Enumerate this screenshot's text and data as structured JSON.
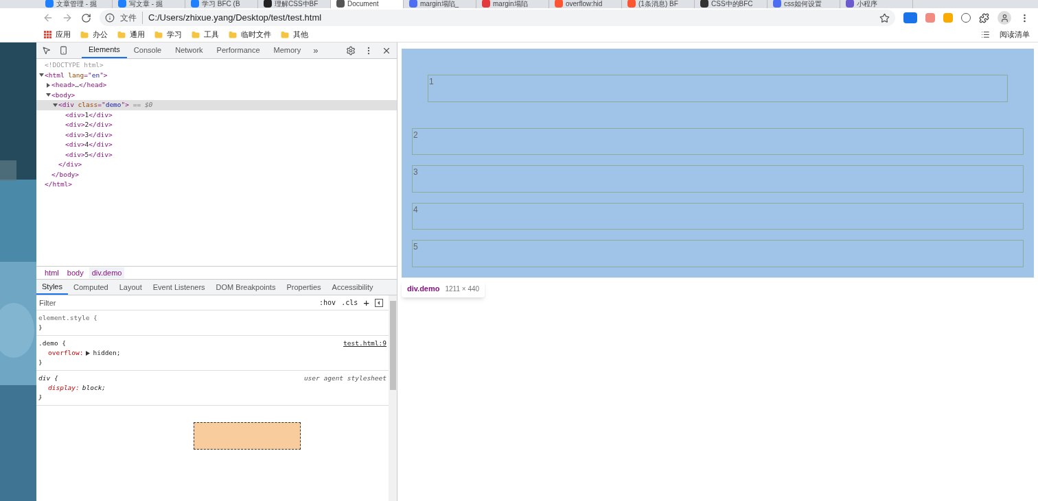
{
  "browser_tabs": [
    {
      "title": "文章管理 - 掘",
      "selected": false,
      "color": "#1e80ff"
    },
    {
      "title": "写文章 - 掘",
      "selected": false,
      "color": "#1e80ff"
    },
    {
      "title": "学习 BFC (B",
      "selected": false,
      "color": "#1e80ff"
    },
    {
      "title": "理解CSS中BF",
      "selected": false,
      "color": "#222222"
    },
    {
      "title": "Document",
      "selected": true,
      "color": "#555555"
    },
    {
      "title": "margin塌陷_",
      "selected": false,
      "color": "#4e6ef2"
    },
    {
      "title": "margin塌陷",
      "selected": false,
      "color": "#e4393c"
    },
    {
      "title": "overflow:hid",
      "selected": false,
      "color": "#fc5531"
    },
    {
      "title": "(1条消息) BF",
      "selected": false,
      "color": "#fc5531"
    },
    {
      "title": "CSS中的BFC",
      "selected": false,
      "color": "#333333"
    },
    {
      "title": "css如何设置",
      "selected": false,
      "color": "#4e6ef2"
    },
    {
      "title": "小程序",
      "selected": false,
      "color": "#6a5acd"
    }
  ],
  "address_bar": {
    "security_label": "文件",
    "url": "C:/Users/zhixue.yang/Desktop/test/test.html"
  },
  "bookmarks": {
    "apps": "应用",
    "folders": [
      "办公",
      "通用",
      "学习",
      "工具",
      "临时文件",
      "其他"
    ],
    "reading_list": "阅读清单"
  },
  "devtools": {
    "tabs": [
      {
        "label": "Elements",
        "selected": true
      },
      {
        "label": "Console",
        "selected": false
      },
      {
        "label": "Network",
        "selected": false
      },
      {
        "label": "Performance",
        "selected": false
      },
      {
        "label": "Memory",
        "selected": false
      }
    ],
    "more_tabs": "»",
    "dom_tree": [
      {
        "parts": [
          {
            "kind": "doctype",
            "t": "<!DOCTYPE html>"
          }
        ],
        "selected": false
      },
      {
        "parts": [
          {
            "kind": "tag",
            "t": "<html "
          },
          {
            "kind": "attr",
            "t": "lang"
          },
          {
            "kind": "tag",
            "t": "=\""
          },
          {
            "kind": "value",
            "t": "en"
          },
          {
            "kind": "tag",
            "t": "\">"
          }
        ],
        "selected": false,
        "expanded": true,
        "close": "</html>",
        "children": [
          {
            "parts": [
              {
                "kind": "tag",
                "t": "<head>"
              },
              {
                "kind": "text",
                "t": "…"
              },
              {
                "kind": "tag",
                "t": "</head>"
              }
            ],
            "selected": false,
            "expanded": false
          },
          {
            "parts": [
              {
                "kind": "tag",
                "t": "<body>"
              }
            ],
            "selected": false,
            "expanded": true,
            "close": "</body>",
            "children": [
              {
                "parts": [
                  {
                    "kind": "tag",
                    "t": "<div "
                  },
                  {
                    "kind": "attr",
                    "t": "class"
                  },
                  {
                    "kind": "tag",
                    "t": "=\""
                  },
                  {
                    "kind": "value",
                    "t": "demo"
                  },
                  {
                    "kind": "tag",
                    "t": "\">"
                  },
                  {
                    "kind": "meta",
                    "t": " == $0"
                  }
                ],
                "selected": true,
                "expanded": true,
                "close": "</div>",
                "children": [
                  {
                    "parts": [
                      {
                        "kind": "tag",
                        "t": "<div>"
                      },
                      {
                        "kind": "text",
                        "t": "1"
                      },
                      {
                        "kind": "tag",
                        "t": "</div>"
                      }
                    ],
                    "selected": false
                  },
                  {
                    "parts": [
                      {
                        "kind": "tag",
                        "t": "<div>"
                      },
                      {
                        "kind": "text",
                        "t": "2"
                      },
                      {
                        "kind": "tag",
                        "t": "</div>"
                      }
                    ],
                    "selected": false
                  },
                  {
                    "parts": [
                      {
                        "kind": "tag",
                        "t": "<div>"
                      },
                      {
                        "kind": "text",
                        "t": "3"
                      },
                      {
                        "kind": "tag",
                        "t": "</div>"
                      }
                    ],
                    "selected": false
                  },
                  {
                    "parts": [
                      {
                        "kind": "tag",
                        "t": "<div>"
                      },
                      {
                        "kind": "text",
                        "t": "4"
                      },
                      {
                        "kind": "tag",
                        "t": "</div>"
                      }
                    ],
                    "selected": false
                  },
                  {
                    "parts": [
                      {
                        "kind": "tag",
                        "t": "<div>"
                      },
                      {
                        "kind": "text",
                        "t": "5"
                      },
                      {
                        "kind": "tag",
                        "t": "</div>"
                      }
                    ],
                    "selected": false
                  }
                ]
              }
            ]
          }
        ]
      }
    ],
    "breadcrumbs": [
      {
        "label": "html",
        "selected": false
      },
      {
        "label": "body",
        "selected": false
      },
      {
        "label": "div.demo",
        "selected": true
      }
    ],
    "pane_tabs": [
      {
        "label": "Styles",
        "selected": true
      },
      {
        "label": "Computed",
        "selected": false
      },
      {
        "label": "Layout",
        "selected": false
      },
      {
        "label": "Event Listeners",
        "selected": false
      },
      {
        "label": "DOM Breakpoints",
        "selected": false
      },
      {
        "label": "Properties",
        "selected": false
      },
      {
        "label": "Accessibility",
        "selected": false
      }
    ],
    "filter": {
      "placeholder": "Filter",
      "hov": ":hov",
      "cls": ".cls",
      "add": "+"
    },
    "rules": [
      {
        "selector": "element.style {",
        "kind": "inline",
        "close": "}"
      },
      {
        "selector": ".demo {",
        "source": "test.html:9",
        "kind": "author",
        "declarations": [
          {
            "property": "overflow:",
            "value": "hidden;",
            "expandable": true
          }
        ],
        "close": "}"
      },
      {
        "selector": "div {",
        "source": "user agent stylesheet",
        "kind": "agent",
        "declarations": [
          {
            "property": "display:",
            "value": "block;",
            "expandable": false
          }
        ],
        "close": "}"
      }
    ]
  },
  "page": {
    "children": [
      "1",
      "2",
      "3",
      "4",
      "5"
    ],
    "tooltip": {
      "selector": "div.demo",
      "size": "1211 × 440"
    }
  }
}
